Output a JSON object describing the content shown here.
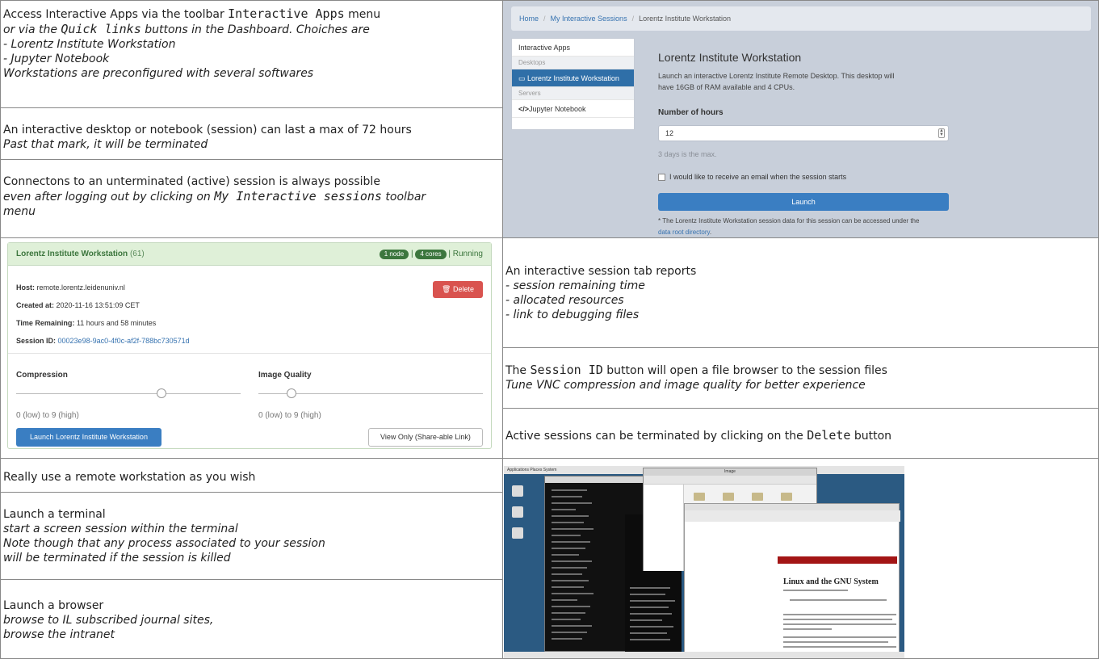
{
  "row1": {
    "cell_a": {
      "l1_pre": "Access Interactive Apps via the toolbar ",
      "l1_code": "Interactive Apps",
      "l1_post": " menu",
      "l2_pre": "or via the ",
      "l2_code": "Quick links",
      "l2_post": " buttons in the Dashboard. Choiches are",
      "l3": "- Lorentz Institute Workstation",
      "l4": "- Jupyter Notebook",
      "l5": "Workstations are preconfigured with several softwares"
    },
    "cell_b": {
      "l1": "An interactive desktop or notebook (session) can last a max of 72 hours",
      "l2": "Past that mark, it will be terminated"
    },
    "cell_c": {
      "l1": "Connectons to an unterminated (active) session is always possible",
      "l2_pre": "even after logging out by clicking on ",
      "l2_code": "My Interactive sessions",
      "l2_post": " toolbar",
      "l3": "menu"
    }
  },
  "launch_form": {
    "breadcrumb": [
      "Home",
      "My Interactive Sessions",
      "Lorentz Institute Workstation"
    ],
    "sidebar": {
      "title": "Interactive Apps",
      "group1": "Desktops",
      "active_item": "Lorentz Institute Workstation",
      "group2": "Servers",
      "item2": "Jupyter Notebook"
    },
    "title": "Lorentz Institute Workstation",
    "desc1": "Launch an interactive Lorentz Institute Remote Desktop. This desktop will",
    "desc2": "have 16GB of RAM available and 4 CPUs.",
    "hours_label": "Number of hours",
    "hours_value": "12",
    "hint": "3 days is the max.",
    "email_label": "I would like to receive an email when the session starts",
    "launch_button": "Launch",
    "note1": "* The Lorentz Institute Workstation session data for this session can be accessed under the",
    "note2_link": "data root directory",
    "note2_post": "."
  },
  "session_card": {
    "title": "Lorentz Institute Workstation",
    "count": "(61)",
    "node_badge": "1 node",
    "cores_badge": "4 cores",
    "sep": "|",
    "status": "Running",
    "host_label": "Host:",
    "host_value": "remote.lorentz.leidenuniv.nl",
    "created_label": "Created at:",
    "created_value": "2020-11-16 13:51:09 CET",
    "time_label": "Time Remaining:",
    "time_value": "11 hours and 58 minutes",
    "id_label": "Session ID:",
    "id_value": "00023e98-9ac0-4f0c-af2f-788bc730571d",
    "delete_button": "Delete",
    "compression_label": "Compression",
    "quality_label": "Image Quality",
    "compression_range": "0 (low) to 9 (high)",
    "quality_range": "0 (low) to 9 (high)",
    "launch_button": "Launch Lorentz Institute Workstation",
    "view_button": "View Only (Share-able Link)"
  },
  "row2": {
    "cell_a": {
      "l1": "An interactive session tab reports",
      "l2": "- session remaining time",
      "l3": "- allocated resources",
      "l4": "- link to debugging files"
    },
    "cell_b": {
      "l1_pre": "The ",
      "l1_code": "Session ID",
      "l1_post": " button will open a file browser to the session files",
      "l2": "Tune VNC compression and image quality for better experience"
    },
    "cell_c": {
      "l1_pre": "Active sessions can be terminated by clicking on the ",
      "l1_code": "Delete",
      "l1_post": " button"
    }
  },
  "row3": {
    "cell_a": {
      "l1": "Really use a remote workstation as you wish"
    },
    "cell_b": {
      "l1": "Launch a terminal",
      "l2": "start a screen session within the terminal",
      "l3": "Note though that any process associated to your session",
      "l4": "will be terminated if the session is killed"
    },
    "cell_c": {
      "l1": "Launch a browser",
      "l2": "browse to IL subscribed journal sites,",
      "l3": "browse the intranet"
    }
  },
  "desktop": {
    "menubar": "Applications  Places  System",
    "file_manager_title": "Image",
    "browser_heading": "Linux and the GNU System"
  }
}
